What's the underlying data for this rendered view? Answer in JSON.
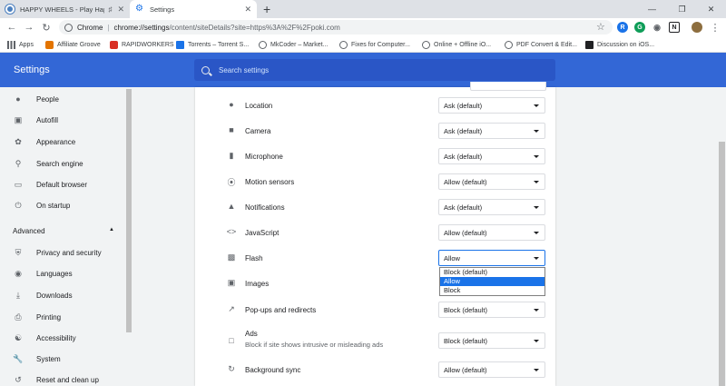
{
  "tabs": [
    {
      "title": "HAPPY WHEELS - Play Happ",
      "favicon_color": "#4a7fbf",
      "active": false
    },
    {
      "title": "Settings",
      "favicon_color": "#1a73e8",
      "active": true
    }
  ],
  "toolbar": {
    "origin": "Chrome",
    "url_scheme": "chrome://settings",
    "url_rest": "/content/siteDetails?site=https%3A%2F%2Fpoki.com"
  },
  "bookmarks": [
    {
      "label": "Apps",
      "icon": "apps-grid-icon",
      "color": "#5f6368"
    },
    {
      "label": "Affiliate Groove",
      "icon": "affiliate-icon",
      "color": "#e37400"
    },
    {
      "label": "RAPIDWORKERS",
      "icon": "rapidworkers-icon",
      "color": "#d93025"
    },
    {
      "label": "Torrents – Torrent S...",
      "icon": "torrent-icon",
      "color": "#1a73e8"
    },
    {
      "label": "MkCoder – Market...",
      "icon": "globe-icon",
      "color": "#5f6368"
    },
    {
      "label": "Fixes for Computer...",
      "icon": "globe-icon",
      "color": "#5f6368"
    },
    {
      "label": "Online + Offline iO...",
      "icon": "globe-icon",
      "color": "#5f6368"
    },
    {
      "label": "PDF Convert & Edit...",
      "icon": "globe-icon",
      "color": "#5f6368"
    },
    {
      "label": "Discussion on iOS...",
      "icon": "discussion-icon",
      "color": "#202124"
    }
  ],
  "header": {
    "title": "Settings",
    "search_placeholder": "Search settings"
  },
  "sidebar": {
    "items": [
      {
        "label": "People",
        "icon": "person-icon"
      },
      {
        "label": "Autofill",
        "icon": "clipboard-icon"
      },
      {
        "label": "Appearance",
        "icon": "palette-icon"
      },
      {
        "label": "Search engine",
        "icon": "search-icon"
      },
      {
        "label": "Default browser",
        "icon": "browser-icon"
      },
      {
        "label": "On startup",
        "icon": "power-icon"
      }
    ],
    "advanced_label": "Advanced",
    "advanced_items": [
      {
        "label": "Privacy and security",
        "icon": "shield-icon"
      },
      {
        "label": "Languages",
        "icon": "globe-icon"
      },
      {
        "label": "Downloads",
        "icon": "download-icon"
      },
      {
        "label": "Printing",
        "icon": "printer-icon"
      },
      {
        "label": "Accessibility",
        "icon": "accessibility-icon"
      },
      {
        "label": "System",
        "icon": "wrench-icon"
      },
      {
        "label": "Reset and clean up",
        "icon": "reset-icon"
      }
    ]
  },
  "permissions": [
    {
      "label": "Location",
      "value": "Ask (default)",
      "icon": "location-pin-icon"
    },
    {
      "label": "Camera",
      "value": "Ask (default)",
      "icon": "camera-icon"
    },
    {
      "label": "Microphone",
      "value": "Ask (default)",
      "icon": "microphone-icon"
    },
    {
      "label": "Motion sensors",
      "value": "Allow (default)",
      "icon": "motion-sensor-icon"
    },
    {
      "label": "Notifications",
      "value": "Ask (default)",
      "icon": "bell-icon"
    },
    {
      "label": "JavaScript",
      "value": "Allow (default)",
      "icon": "code-icon"
    },
    {
      "label": "Flash",
      "value": "Allow",
      "icon": "puzzle-icon"
    },
    {
      "label": "Images",
      "value": "",
      "icon": "image-icon"
    },
    {
      "label": "Pop-ups and redirects",
      "value": "Block (default)",
      "icon": "popup-icon"
    },
    {
      "label": "Ads",
      "sublabel": "Block if site shows intrusive or misleading ads",
      "value": "Block (default)",
      "icon": "ads-icon"
    },
    {
      "label": "Background sync",
      "value": "Allow (default)",
      "icon": "sync-icon"
    }
  ],
  "flash_dropdown": {
    "options": [
      "Block (default)",
      "Allow",
      "Block"
    ],
    "highlighted": "Allow"
  },
  "colors": {
    "header_blue": "#3367d6",
    "accent": "#1a73e8"
  }
}
